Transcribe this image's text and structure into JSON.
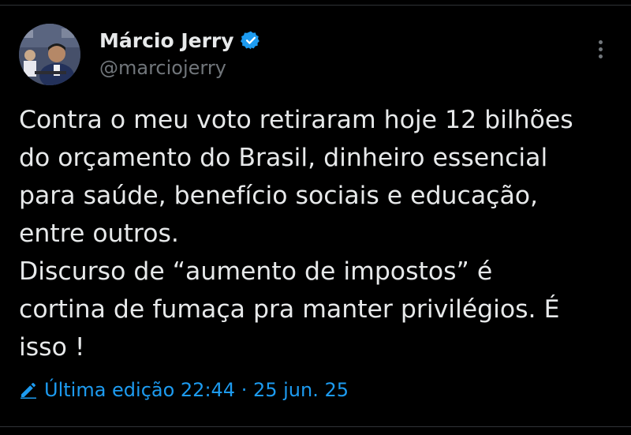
{
  "author": {
    "display_name": "Márcio Jerry",
    "handle": "@marciojerry",
    "verified": true
  },
  "tweet": {
    "lines": [
      "Contra o meu voto retiraram hoje 12 bilhões",
      "do orçamento do Brasil, dinheiro essencial",
      "para saúde, benefício sociais e educação,",
      "entre outros.",
      "Discurso de “aumento de impostos” é",
      "cortina de fumaça pra manter privilégios. É",
      "isso !"
    ]
  },
  "edit_info": {
    "label": "Última edição 22:44 · 25 jun. 25",
    "icon": "pencil-icon"
  },
  "icons": {
    "verified": "verified-badge-icon",
    "more": "more-options-icon"
  },
  "colors": {
    "background": "#000000",
    "text": "#e7e9ea",
    "secondary_text": "#71767b",
    "accent": "#1d9bf0",
    "divider": "#2f3336"
  }
}
